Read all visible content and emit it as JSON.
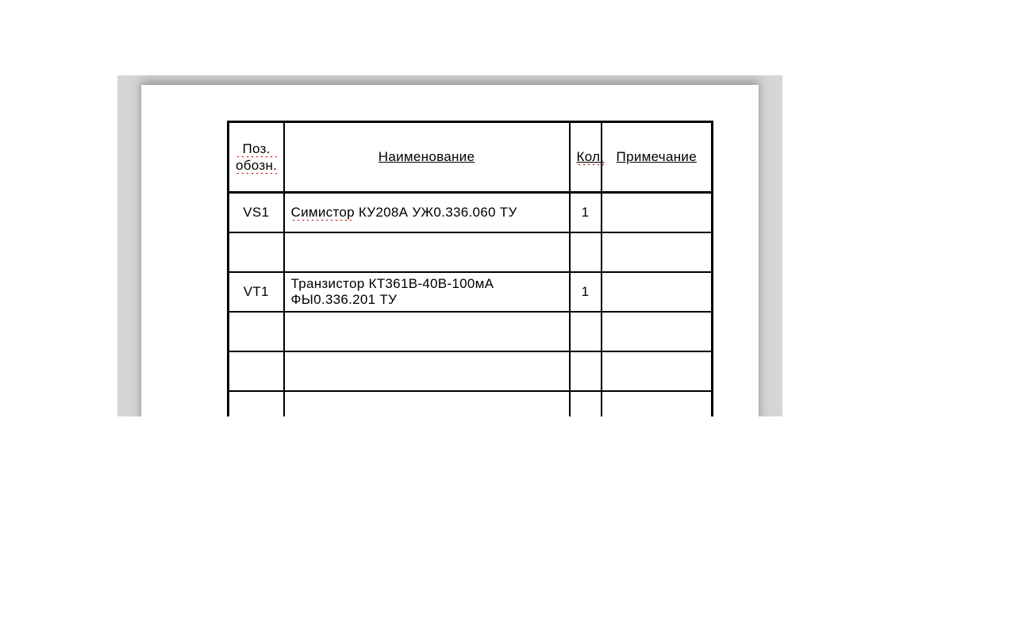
{
  "headers": {
    "pos_line1": "Поз.",
    "pos_line2": "обозн.",
    "name": "Наименование",
    "qty": "Кол.",
    "note": "Примечание"
  },
  "rows": [
    {
      "pos": "VS1",
      "name_w1": "Симистор",
      "name_rest": " КУ208А УЖ0.336.060 ТУ",
      "qty": "1",
      "note": ""
    },
    {
      "pos": "",
      "name_w1": "",
      "name_rest": "",
      "qty": "",
      "note": ""
    },
    {
      "pos": "VT1",
      "name_w1": "",
      "name_rest": "Транзистор КТ361В-40В-100мА ФЫ0.336.201 ТУ",
      "qty": "1",
      "note": ""
    },
    {
      "pos": "",
      "name_w1": "",
      "name_rest": "",
      "qty": "",
      "note": ""
    },
    {
      "pos": "",
      "name_w1": "",
      "name_rest": "",
      "qty": "",
      "note": ""
    },
    {
      "pos": "",
      "name_w1": "",
      "name_rest": "",
      "qty": "",
      "note": ""
    }
  ]
}
